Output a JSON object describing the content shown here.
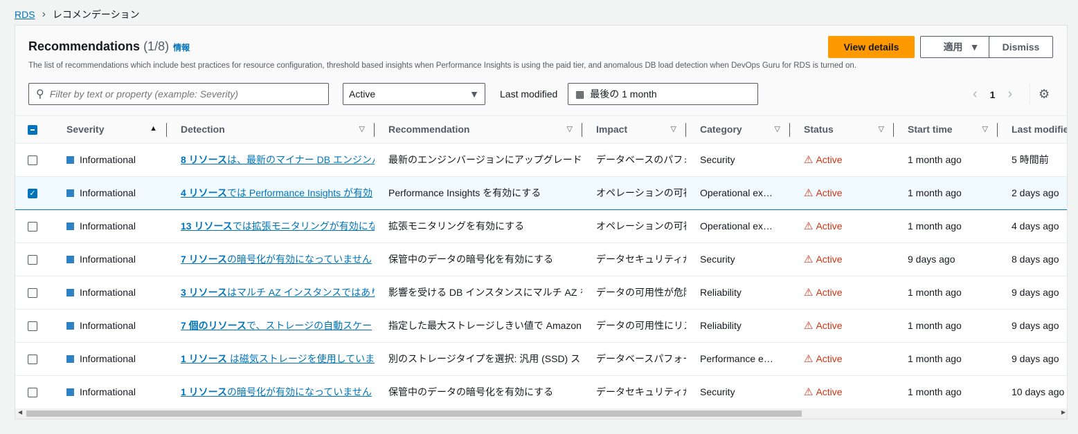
{
  "breadcrumb": {
    "root": "RDS",
    "current": "レコメンデーション"
  },
  "header": {
    "title": "Recommendations",
    "count": "(1/8)",
    "info": "情報",
    "description": "The list of recommendations which include best practices for resource configuration, threshold based insights when Performance Insights is using the paid tier, and anomalous DB load detection when DevOps Guru for RDS is turned on.",
    "view_details": "View details",
    "apply": "適用",
    "dismiss": "Dismiss"
  },
  "filters": {
    "placeholder": "Filter by text or property (example: Severity)",
    "status": "Active",
    "last_modified_label": "Last modified",
    "date_range": "最後の 1 month",
    "page": "1"
  },
  "columns": [
    "Severity",
    "Detection",
    "Recommendation",
    "Impact",
    "Category",
    "Status",
    "Start time",
    "Last modified"
  ],
  "colors": {
    "accent": "#0073bb",
    "primary_button": "#ff9900",
    "status_active": "#d13212"
  },
  "rows": [
    {
      "checked": false,
      "severity": "Informational",
      "det_bold": "8 リソース",
      "det_rest": "は、最新のマイナー DB エンジンバ",
      "recommendation": "最新のエンジンバージョンにアップグレード",
      "impact": "データベースのパフォ",
      "category": "Security",
      "status": "Active",
      "start": "1 month ago",
      "modified": "5 時間前"
    },
    {
      "checked": true,
      "severity": "Informational",
      "det_bold": "4 リソース",
      "det_rest": "では Performance Insights が有効",
      "recommendation": "Performance Insights を有効にする",
      "impact": "オペレーションの可視",
      "category": "Operational ex…",
      "status": "Active",
      "start": "1 month ago",
      "modified": "2 days ago"
    },
    {
      "checked": false,
      "severity": "Informational",
      "det_bold": "13 リソース",
      "det_rest": "では拡張モニタリングが有効にな",
      "recommendation": "拡張モニタリングを有効にする",
      "impact": "オペレーションの可視",
      "category": "Operational ex…",
      "status": "Active",
      "start": "1 month ago",
      "modified": "4 days ago"
    },
    {
      "checked": false,
      "severity": "Informational",
      "det_bold": "7 リソース",
      "det_rest": "の暗号化が有効になっていません",
      "recommendation": "保管中のデータの暗号化を有効にする",
      "impact": "データセキュリティが",
      "category": "Security",
      "status": "Active",
      "start": "9 days ago",
      "modified": "8 days ago"
    },
    {
      "checked": false,
      "severity": "Informational",
      "det_bold": "3 リソース",
      "det_rest": "はマルチ AZ インスタンスではあり",
      "recommendation": "影響を受ける DB インスタンスにマルチ AZ を",
      "impact": "データの可用性が危険",
      "category": "Reliability",
      "status": "Active",
      "start": "1 month ago",
      "modified": "9 days ago"
    },
    {
      "checked": false,
      "severity": "Informational",
      "det_bold": "7 個のリソース",
      "det_rest": "で、ストレージの自動スケー",
      "recommendation": "指定した最大ストレージしきい値で Amazon",
      "impact": "データの可用性にリス",
      "category": "Reliability",
      "status": "Active",
      "start": "1 month ago",
      "modified": "9 days ago"
    },
    {
      "checked": false,
      "severity": "Informational",
      "det_bold": "1 リソース",
      "det_rest": " は磁気ストレージを使用していま",
      "recommendation": "別のストレージタイプを選択: 汎用 (SSD) スト",
      "impact": "データベースパフォー",
      "category": "Performance e…",
      "status": "Active",
      "start": "1 month ago",
      "modified": "9 days ago"
    },
    {
      "checked": false,
      "severity": "Informational",
      "det_bold": "1 リソース",
      "det_rest": "の暗号化が有効になっていません",
      "recommendation": "保管中のデータの暗号化を有効にする",
      "impact": "データセキュリティが",
      "category": "Security",
      "status": "Active",
      "start": "1 month ago",
      "modified": "10 days ago"
    }
  ]
}
